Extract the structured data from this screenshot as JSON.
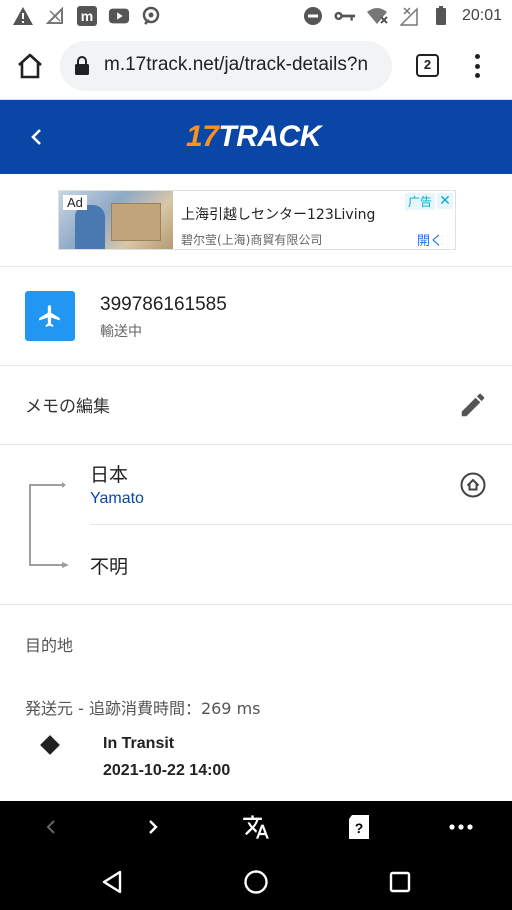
{
  "status_bar": {
    "time": "20:01",
    "left_icons": [
      "warning-icon",
      "no-signal-icon",
      "m-app-icon",
      "youtube-icon",
      "location-pin-icon"
    ],
    "right_icons": [
      "do-not-disturb-icon",
      "key-icon",
      "wifi-icon",
      "no-sim-icon",
      "battery-icon"
    ]
  },
  "browser": {
    "url": "m.17track.net/ja/track-details?n",
    "tab_count": "2"
  },
  "header": {
    "logo_num": "17",
    "logo_word": "TRACK",
    "brand_color": "#0a46a5",
    "accent_color": "#f7931e"
  },
  "ad": {
    "tag": "Ad",
    "title": "上海引越しセンター123Living",
    "company": "碧尔莹(上海)商貿有限公司",
    "badge": "广告",
    "close": "✕",
    "open_label": "開く"
  },
  "tracking": {
    "number": "399786161585",
    "status": "輸送中"
  },
  "memo": {
    "label": "メモの編集"
  },
  "route": {
    "origin_country": "日本",
    "carrier": "Yamato",
    "destination_country": "不明"
  },
  "details": {
    "destination_label": "目的地",
    "source_line": "発送元 - 追跡消費時間：269 ms",
    "events": [
      {
        "status": "In Transit",
        "time": "2021-10-22 14:00"
      }
    ]
  }
}
